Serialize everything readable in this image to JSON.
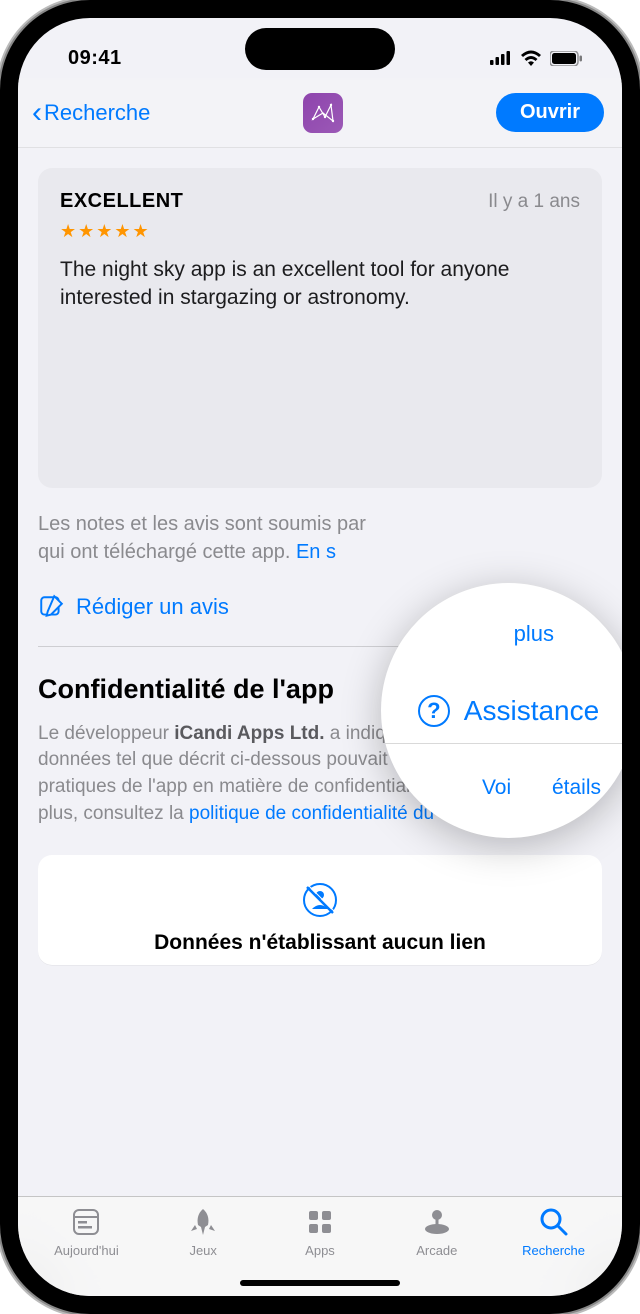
{
  "status": {
    "time": "09:41"
  },
  "nav": {
    "back_label": "Recherche",
    "open_label": "Ouvrir"
  },
  "review": {
    "title": "EXCELLENT",
    "date": "Il y a 1 ans",
    "rating": 5,
    "text": "The night sky app is an excellent tool for anyone interested in stargazing or astronomy."
  },
  "notes": {
    "disclaimer_prefix": "Les notes et les avis sont soumis par",
    "disclaimer_suffix": "qui ont téléchargé cette app. ",
    "learn_more": "En savoir plus"
  },
  "actions": {
    "write_review": "Rédiger un avis"
  },
  "magnifier": {
    "plus": "plus",
    "assistance": "Assistance",
    "details_fragment": "Voir les détails"
  },
  "privacy": {
    "title": "Confidentialité de l'app",
    "see_details": "Voir les détails",
    "text_prefix": "Le développeur ",
    "developer": "iCandi Apps Ltd.",
    "text_mid": " a indiqué que le traitement des données tel que décrit ci-dessous pouvait figurer parmi les pratiques de l'app en matière de confidentialité. Pour en savoir plus, consultez la ",
    "policy_link": "politique de confidentialité du développeur",
    "text_end": "."
  },
  "data_card": {
    "title": "Données n'établissant aucun lien"
  },
  "tabs": {
    "today": "Aujourd'hui",
    "games": "Jeux",
    "apps": "Apps",
    "arcade": "Arcade",
    "search": "Recherche"
  }
}
